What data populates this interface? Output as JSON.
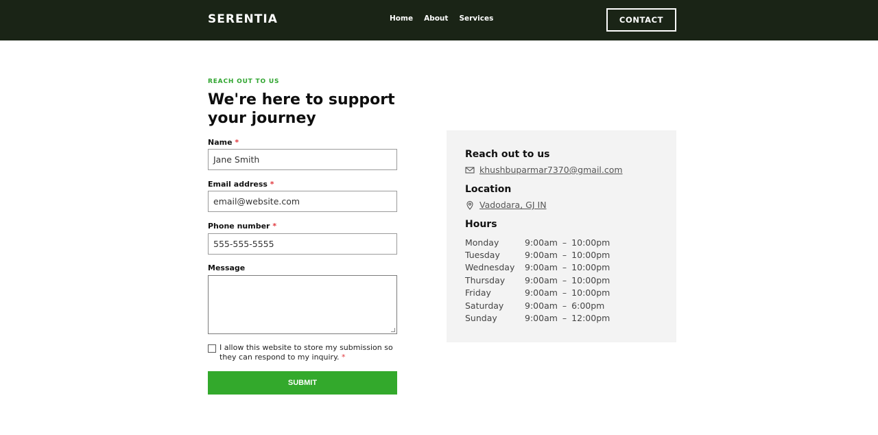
{
  "header": {
    "brand": "SERENTIA",
    "nav": [
      "Home",
      "About",
      "Services"
    ],
    "cta": "CONTACT"
  },
  "form": {
    "eyebrow": "REACH OUT TO US",
    "headline": "We're here to support your journey",
    "required_mark": "*",
    "fields": [
      {
        "label": "Name",
        "value": "Jane Smith",
        "required": true
      },
      {
        "label": "Email address",
        "value": "email@website.com",
        "required": true
      },
      {
        "label": "Phone number",
        "value": "555-555-5555",
        "required": true
      }
    ],
    "message_label": "Message",
    "consent_text": "I allow this website to store my submission so they can respond to my inquiry.",
    "submit_label": "SUBMIT"
  },
  "info": {
    "reach_title": "Reach out to us",
    "email": "khushbuparmar7370@gmail.com",
    "location_title": "Location",
    "location": "Vadodara, GJ IN",
    "hours_title": "Hours",
    "hours": [
      {
        "day": "Monday",
        "open": "9:00am",
        "sep": "–",
        "close": "10:00pm"
      },
      {
        "day": "Tuesday",
        "open": "9:00am",
        "sep": "–",
        "close": "10:00pm"
      },
      {
        "day": "Wednesday",
        "open": "9:00am",
        "sep": "–",
        "close": "10:00pm"
      },
      {
        "day": "Thursday",
        "open": "9:00am",
        "sep": "–",
        "close": "10:00pm"
      },
      {
        "day": "Friday",
        "open": "9:00am",
        "sep": "–",
        "close": "10:00pm"
      },
      {
        "day": "Saturday",
        "open": "9:00am",
        "sep": "–",
        "close": "6:00pm"
      },
      {
        "day": "Sunday",
        "open": "9:00am",
        "sep": "–",
        "close": "12:00pm"
      }
    ]
  },
  "colors": {
    "header_bg": "#1a2416",
    "accent_green": "#33a92c",
    "required_red": "#e0393e",
    "panel_bg": "#f3f3f3"
  },
  "icons": {
    "email": "envelope-icon",
    "location": "map-pin-icon"
  }
}
